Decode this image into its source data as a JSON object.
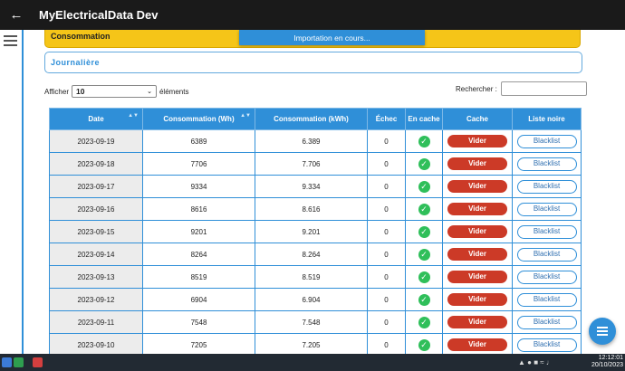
{
  "app": {
    "title": "MyElectricalData Dev"
  },
  "banner": {
    "section": "Consommation",
    "status": "Importation en cours..."
  },
  "panel": {
    "title": "Journalière"
  },
  "controls": {
    "show_label": "Afficher",
    "page_size": "10",
    "entries_label": "éléments",
    "search_label": "Rechercher :",
    "search_value": ""
  },
  "table": {
    "headers": [
      "Date",
      "Consommation (Wh)",
      "Consommation (kWh)",
      "Échec",
      "En cache",
      "Cache",
      "Liste noire"
    ],
    "rows": [
      {
        "date": "2023-09-19",
        "wh": "6389",
        "kwh": "6.389",
        "fail": "0",
        "clear": "Vider",
        "blacklist": "Blacklist"
      },
      {
        "date": "2023-09-18",
        "wh": "7706",
        "kwh": "7.706",
        "fail": "0",
        "clear": "Vider",
        "blacklist": "Blacklist"
      },
      {
        "date": "2023-09-17",
        "wh": "9334",
        "kwh": "9.334",
        "fail": "0",
        "clear": "Vider",
        "blacklist": "Blacklist"
      },
      {
        "date": "2023-09-16",
        "wh": "8616",
        "kwh": "8.616",
        "fail": "0",
        "clear": "Vider",
        "blacklist": "Blacklist"
      },
      {
        "date": "2023-09-15",
        "wh": "9201",
        "kwh": "9.201",
        "fail": "0",
        "clear": "Vider",
        "blacklist": "Blacklist"
      },
      {
        "date": "2023-09-14",
        "wh": "8264",
        "kwh": "8.264",
        "fail": "0",
        "clear": "Vider",
        "blacklist": "Blacklist"
      },
      {
        "date": "2023-09-13",
        "wh": "8519",
        "kwh": "8.519",
        "fail": "0",
        "clear": "Vider",
        "blacklist": "Blacklist"
      },
      {
        "date": "2023-09-12",
        "wh": "6904",
        "kwh": "6.904",
        "fail": "0",
        "clear": "Vider",
        "blacklist": "Blacklist"
      },
      {
        "date": "2023-09-11",
        "wh": "7548",
        "kwh": "7.548",
        "fail": "0",
        "clear": "Vider",
        "blacklist": "Blacklist"
      },
      {
        "date": "2023-09-10",
        "wh": "7205",
        "kwh": "7.205",
        "fail": "0",
        "clear": "Vider",
        "blacklist": "Blacklist"
      }
    ]
  },
  "taskbar": {
    "time": "12:12:01",
    "date": "20/10/2023"
  },
  "icons": {
    "back": "arrow-left-icon",
    "menu": "hamburger-icon",
    "cached": "check-circle-icon",
    "fab": "menu-icon"
  },
  "colors": {
    "accent": "#2f8fd8",
    "banner": "#f5c518",
    "danger": "#cc3a27",
    "success": "#2fbf5a",
    "appbar": "#1a1a1a"
  }
}
